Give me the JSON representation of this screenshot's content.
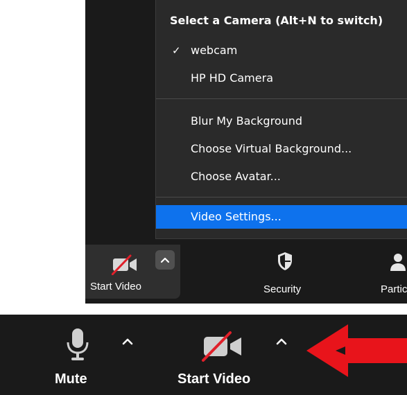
{
  "camera_menu": {
    "header": "Select a Camera (Alt+N to switch)",
    "cameras": [
      {
        "label": "webcam",
        "checked": true
      },
      {
        "label": "HP HD Camera",
        "checked": false
      }
    ],
    "background_options": [
      {
        "label": "Blur My Background"
      },
      {
        "label": "Choose Virtual Background..."
      },
      {
        "label": "Choose Avatar..."
      }
    ],
    "settings_item": {
      "label": "Video Settings...",
      "highlighted": true
    },
    "check_glyph": "✓"
  },
  "top_toolbar": {
    "start_video_label": "Start Video",
    "security_label": "Security",
    "participants_label": "Partic"
  },
  "bottom_toolbar": {
    "mute_label": "Mute",
    "start_video_label": "Start Video"
  },
  "icons": {
    "video_off": "video-off-icon",
    "caret": "chevron-up-icon",
    "security": "shield-icon",
    "participants": "participants-icon",
    "microphone": "microphone-icon",
    "annotation_arrow": "red-arrow-icon"
  },
  "colors": {
    "panel_background": "#1a1a1a",
    "menu_background": "#2a2a2a",
    "highlight": "#0e72ed",
    "slash_red": "#e0202a",
    "arrow_red": "#e8141b",
    "text": "#ffffff"
  }
}
